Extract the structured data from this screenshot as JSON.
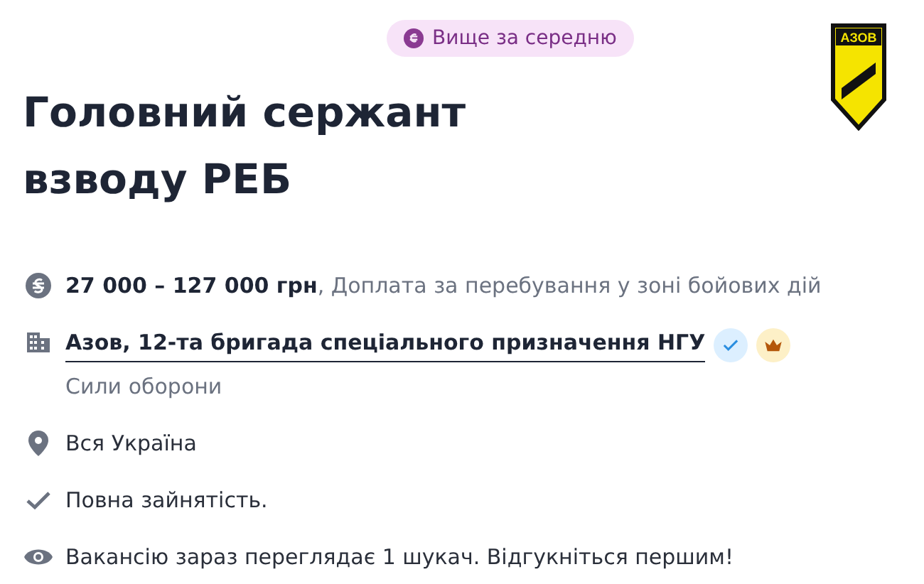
{
  "badge": {
    "text": "Вище за середню"
  },
  "logo": {
    "text": "АЗОВ"
  },
  "title": "Головний сержант взводу РЕБ",
  "details": [
    {
      "kind": "salary",
      "text": "**27 000 – 127 000 грн**, Доплата за перебування у зоні бойових дій"
    },
    {
      "kind": "company",
      "text": "Азов, 12-та бригада спеціального призначення НГУ",
      "subtitle": "Сили оборони",
      "verified": true,
      "premium": true
    },
    {
      "kind": "location",
      "text": "Вся Україна"
    },
    {
      "kind": "employment",
      "text": "Повна зайнятість."
    },
    {
      "kind": "views",
      "text": "Вакансію зараз переглядає 1 шукач. Відгукніться першим!"
    }
  ]
}
